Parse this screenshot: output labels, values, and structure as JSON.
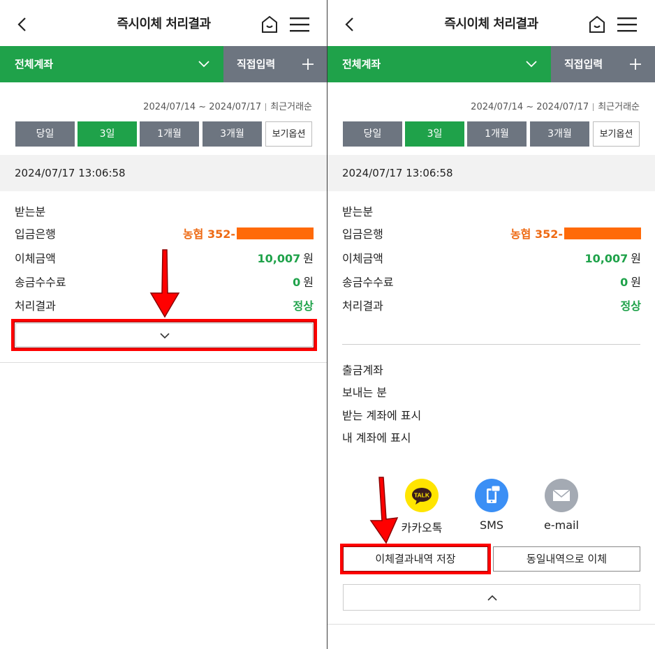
{
  "header": {
    "title": "즉시이체 처리결과"
  },
  "account_bar": {
    "all_label": "전체계좌",
    "direct_label": "직접입력"
  },
  "filter": {
    "range": "2024/07/14 ~ 2024/07/17",
    "sort": "최근거래순",
    "periods": [
      "당일",
      "3일",
      "1개월",
      "3개월"
    ],
    "selected_period": "3일",
    "options_label": "보기옵션"
  },
  "transaction": {
    "datetime": "2024/07/17 13:06:58",
    "recipient_label": "받는분",
    "bank_label": "입금은행",
    "bank_value": "농협 352-",
    "amount_label": "이체금액",
    "amount_value": "10,007",
    "amount_unit": "원",
    "fee_label": "송금수수료",
    "fee_value": "0",
    "fee_unit": "원",
    "result_label": "처리결과",
    "result_value": "정상"
  },
  "details": {
    "withdraw_account": "출금계좌",
    "sender": "보내는 분",
    "show_on_recipient": "받는 계좌에 표시",
    "show_on_mine": "내 계좌에 표시"
  },
  "share": {
    "kakao_icon_text": "TALK",
    "kakao_label": "카카오톡",
    "sms_label": "SMS",
    "email_label": "e-mail"
  },
  "actions": {
    "save_label": "이체결과내역 저장",
    "repeat_label": "동일내역으로 이체"
  },
  "colors": {
    "brand_green": "#1fa24a",
    "gray_button": "#6d7580",
    "orange_value": "#ee6a14",
    "highlight_red": "#ff0000",
    "kakao_yellow": "#ffe500",
    "sms_blue": "#3b8ff5",
    "email_gray": "#a4aab3"
  }
}
